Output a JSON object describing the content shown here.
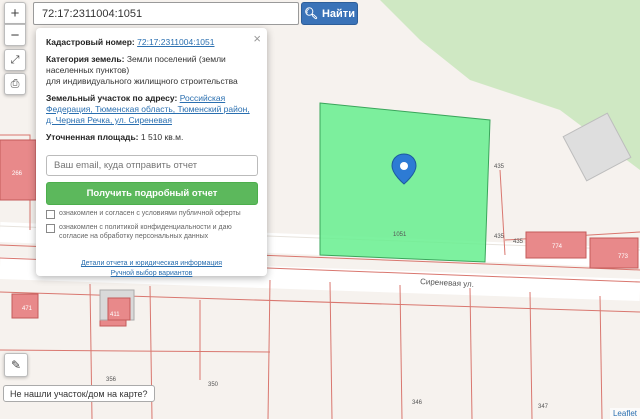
{
  "search": {
    "value": "72:17:2311004:1051",
    "button_label": "Найти"
  },
  "zoom": {
    "in": "+",
    "out": "−"
  },
  "popup": {
    "cad_label": "Кадастровый номер:",
    "cad_value": "72:17:2311004:1051",
    "cat_label": "Категория земель:",
    "cat_value": "Земли поселений (земли населенных пунктов)",
    "cat_use": "для индивидуального жилищного строительства",
    "addr_label": "Земельный участок по адресу:",
    "addr_value": "Российская Федерация, Тюменская область, Тюменский район, д. Черная Речка, ул. Сиреневая",
    "area_label": "Уточненная площадь:",
    "area_value": "1 510 кв.м.",
    "email_placeholder": "Ваш email, куда отправить отчет",
    "report_button": "Получить подробный отчет",
    "agree1": "ознакомлен и согласен с условиями публичной оферты",
    "agree2": "ознакомлен с политикой конфиденциальности и даю согласие на обработку персональных данных",
    "link_details": "Детали отчета и юридическая информация",
    "link_manual": "Ручной выбор вариантов"
  },
  "map_labels": {
    "plot": "1051",
    "street": "Сиреневая ул.",
    "n435a": "435",
    "n435b": "435",
    "n435c": "435",
    "n774": "774",
    "n773": "773",
    "n356": "356",
    "n350": "350",
    "n346": "346",
    "n347": "347",
    "n471": "471",
    "n411": "411",
    "n266": "266"
  },
  "not_found": "Не нашли участок/дом на карте?",
  "attribution": "Leaflet"
}
